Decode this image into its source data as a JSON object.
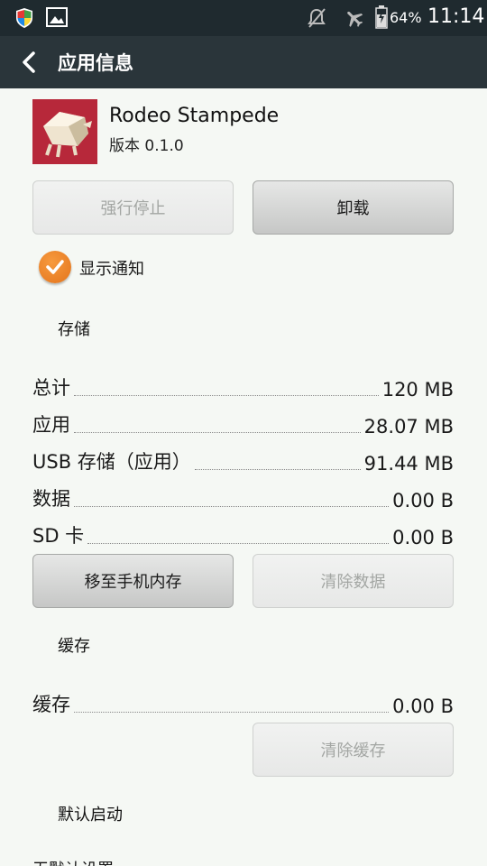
{
  "status_bar": {
    "battery_percent": "64%",
    "time": "11:14"
  },
  "header": {
    "back_icon": "chevron-left-icon",
    "title": "应用信息"
  },
  "app": {
    "name": "Rodeo Stampede",
    "version": "版本 0.1.0"
  },
  "buttons": {
    "force_stop": "强行停止",
    "uninstall": "卸载",
    "move_to_phone": "移至手机内存",
    "clear_data": "清除数据",
    "clear_cache": "清除缓存"
  },
  "notification": {
    "label": "显示通知",
    "checked": true
  },
  "storage": {
    "section_title": "存储",
    "rows": [
      {
        "label": "总计",
        "value": "120 MB"
      },
      {
        "label": "应用",
        "value": "28.07 MB"
      },
      {
        "label": "USB 存储（应用）",
        "value": "91.44 MB"
      },
      {
        "label": "数据",
        "value": "0.00 B"
      },
      {
        "label": "SD 卡",
        "value": "0.00 B"
      }
    ]
  },
  "cache": {
    "section_title": "缓存",
    "rows": [
      {
        "label": "缓存",
        "value": "0.00 B"
      }
    ]
  },
  "default_launch": {
    "section_title": "默认启动",
    "partial_text": "无默认设置"
  },
  "colors": {
    "status_bar_bg": "#1f2a2f",
    "app_bar_bg": "#2a353a",
    "content_bg": "#f5f8f4",
    "checkbox_orange": "#e97f22",
    "app_icon_bg": "#b8283a"
  }
}
